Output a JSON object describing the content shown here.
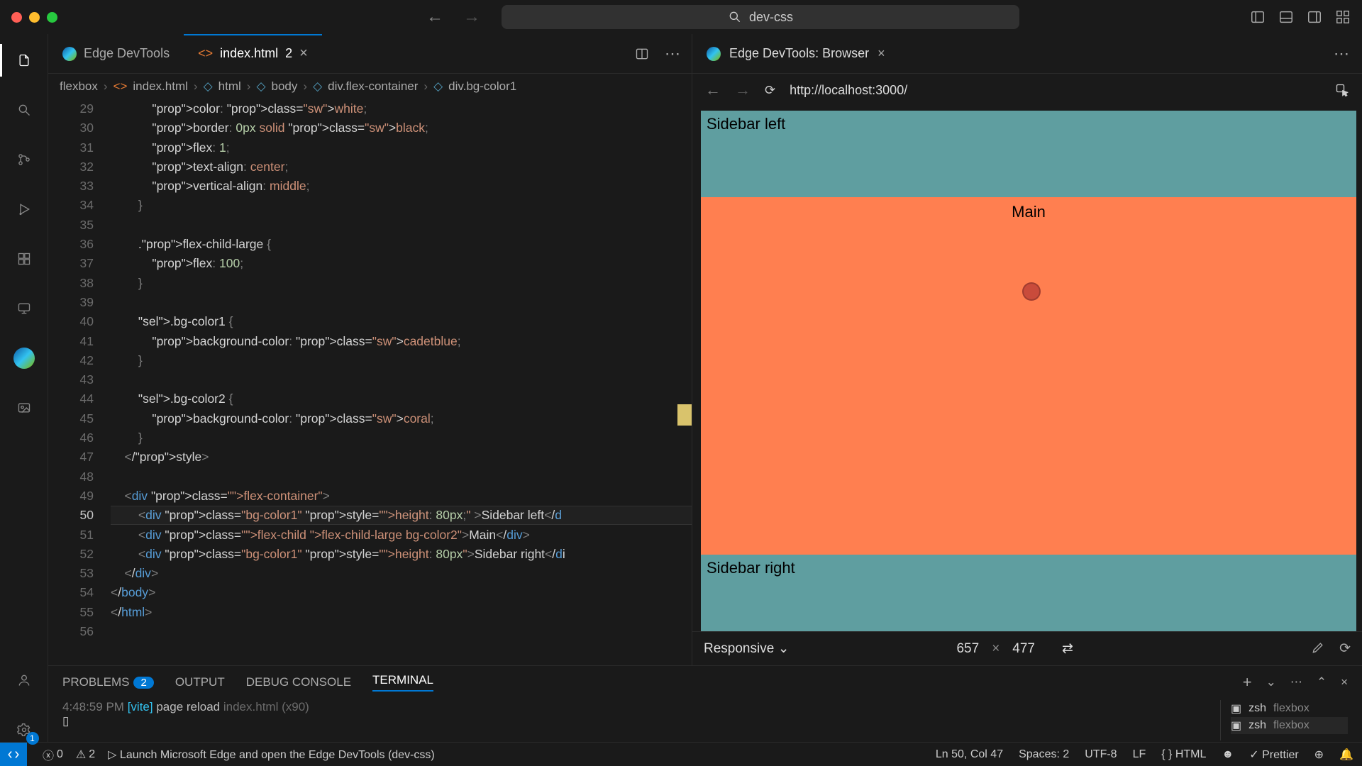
{
  "title": {
    "search_text": "dev-css"
  },
  "activity": {
    "settings_badge": "1"
  },
  "tabs": [
    {
      "label": "Edge DevTools"
    },
    {
      "label": "index.html",
      "dirty": "2"
    }
  ],
  "breadcrumbs": {
    "root": "flexbox",
    "file": "index.html",
    "p1": "html",
    "p2": "body",
    "p3": "div.flex-container",
    "p4": "div.bg-color1"
  },
  "code": {
    "first_line": 29,
    "lines": [
      "            color: ▢white;",
      "            border: 0px solid ▢black;",
      "            flex: 1;",
      "            text-align: center;",
      "            vertical-align: middle;",
      "        }",
      "",
      "        .flex-child-large {",
      "            flex: 100;",
      "        }",
      "",
      "        .bg-color1 {",
      "            background-color: ▢cadetblue;",
      "        }",
      "",
      "        .bg-color2 {",
      "            background-color: ▢coral;",
      "        }",
      "    </style>",
      "",
      "    <div class=\"flex-container\">",
      "        <div class=\"bg-color1\" style=\"height: 80px;\" >Sidebar left</d",
      "        <div class=\"flex-child flex-child-large bg-color2\">Main</div>",
      "        <div class=\"bg-color1\" style=\"height: 80px\">Sidebar right</di",
      "    </div>",
      "</body>",
      "</html>",
      ""
    ]
  },
  "browser": {
    "tab": "Edge DevTools: Browser",
    "url": "http://localhost:3000/",
    "preview": {
      "side_left": "Sidebar left",
      "main": "Main",
      "side_right": "Sidebar right"
    },
    "responsive": "Responsive",
    "w": "657",
    "h": "477"
  },
  "panel": {
    "tabs": {
      "problems": "PROBLEMS",
      "problems_count": "2",
      "output": "OUTPUT",
      "debug": "DEBUG CONSOLE",
      "terminal": "TERMINAL"
    },
    "terminal": {
      "ts": "4:48:59 PM",
      "tag": "[vite]",
      "msg": "page reload",
      "file": "index.html",
      "count": "(x90)"
    },
    "shells": [
      {
        "sh": "zsh",
        "name": "flexbox"
      },
      {
        "sh": "zsh",
        "name": "flexbox"
      }
    ]
  },
  "status": {
    "errors": "0",
    "warnings": "2",
    "launch": "Launch Microsoft Edge and open the Edge DevTools (dev-css)",
    "cursor": "Ln 50, Col 47",
    "spaces": "Spaces: 2",
    "enc": "UTF-8",
    "eol": "LF",
    "lang": "HTML",
    "prettier": "Prettier"
  }
}
